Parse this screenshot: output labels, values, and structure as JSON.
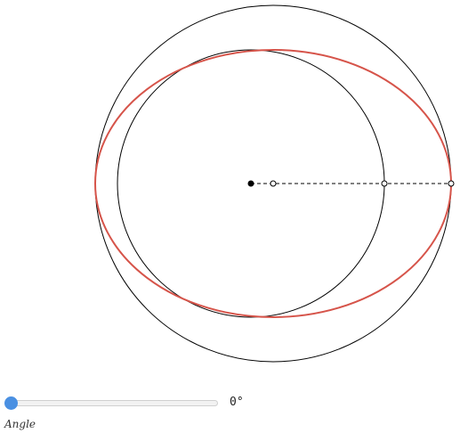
{
  "colors": {
    "ellipse": "#d6544a",
    "circle": "#000000",
    "slider_accent": "#4a90e2",
    "background": "#ffffff"
  },
  "slider": {
    "label": "Angle",
    "value": 0,
    "value_text": "0°",
    "min": 0,
    "max": 360
  }
}
